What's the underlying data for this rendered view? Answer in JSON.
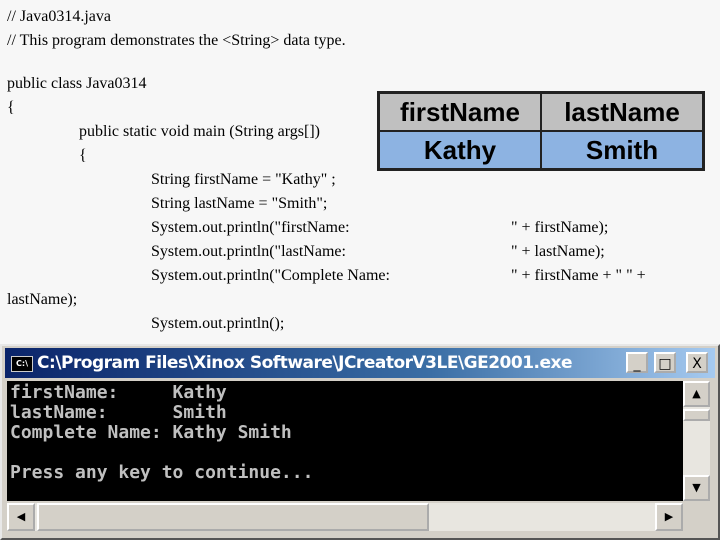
{
  "code": {
    "lines": [
      "// Java0314.java",
      "// This program demonstrates the <String> data type.",
      "public class Java0314",
      "{",
      "public static void main (String args[])",
      "{",
      "String firstName = \"Kathy\" ;",
      "String lastName = \"Smith\";",
      "System.out.println(\"firstName:",
      "\" + firstName);",
      "System.out.println(\"lastName:",
      "\" + lastName);",
      "System.out.println(\"Complete Name:",
      "\" + firstName + \" \" +",
      "lastName);",
      "System.out.println();"
    ]
  },
  "memory_table": {
    "headers": [
      "firstName",
      "lastName"
    ],
    "values": [
      "Kathy",
      "Smith"
    ]
  },
  "window": {
    "title": "C:\\Program Files\\Xinox Software\\JCreatorV3LE\\GE2001.exe",
    "icon_label": "C:\\",
    "minimize": "_",
    "maximize": "□",
    "close": "X"
  },
  "console_output": "firstName:     Kathy\nlastName:      Smith\nComplete Name: Kathy Smith\n\nPress any key to continue..."
}
